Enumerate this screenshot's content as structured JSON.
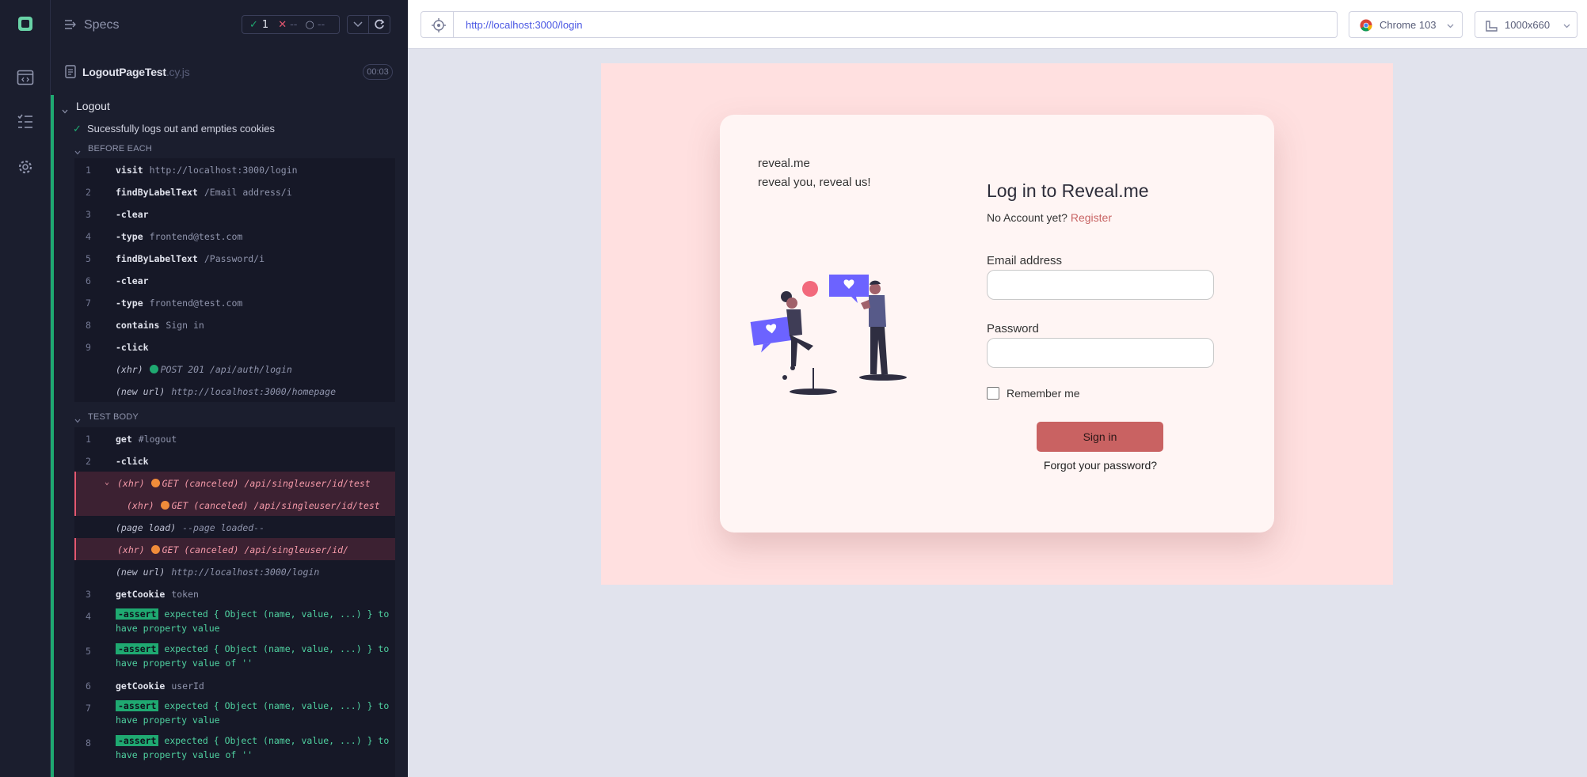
{
  "sidebar": {
    "icons": [
      "cypress-logo-icon",
      "browser-icon",
      "list-icon",
      "gear-icon"
    ]
  },
  "reporter": {
    "specs_label": "Specs",
    "stats": {
      "passed": "1",
      "failed": "--",
      "pending": "--"
    },
    "file": {
      "name": "LogoutPageTest",
      "ext": ".cy.js",
      "duration": "00:03"
    },
    "suite": "Logout",
    "test": "Sucessfully logs out and empties cookies",
    "before_each_label": "BEFORE EACH",
    "test_body_label": "TEST BODY",
    "before_each": [
      {
        "num": "1",
        "name": "visit",
        "msg": "http://localhost:3000/login"
      },
      {
        "num": "2",
        "name": "findByLabelText",
        "msg": "/Email address/i"
      },
      {
        "num": "3",
        "name": "-clear",
        "msg": ""
      },
      {
        "num": "4",
        "name": "-type",
        "msg": "frontend@test.com"
      },
      {
        "num": "5",
        "name": "findByLabelText",
        "msg": "/Password/i"
      },
      {
        "num": "6",
        "name": "-clear",
        "msg": ""
      },
      {
        "num": "7",
        "name": "-type",
        "msg": "frontend@test.com"
      },
      {
        "num": "8",
        "name": "contains",
        "msg": "Sign in"
      },
      {
        "num": "9",
        "name": "-click",
        "msg": ""
      },
      {
        "num": "",
        "name": "(xhr)",
        "msg": "POST 201 /api/auth/login"
      },
      {
        "num": "",
        "name": "(new url)",
        "msg": "http://localhost:3000/homepage"
      }
    ],
    "test_body": [
      {
        "num": "1",
        "name": "get",
        "msg": "#logout"
      },
      {
        "num": "2",
        "name": "-click",
        "msg": ""
      },
      {
        "num": "",
        "name": "(xhr)",
        "msg": "GET (canceled) /api/singleuser/id/test"
      },
      {
        "num": "",
        "name": "(xhr)",
        "msg": "GET (canceled) /api/singleuser/id/test"
      },
      {
        "num": "",
        "name": "(page load)",
        "msg": "--page loaded--"
      },
      {
        "num": "",
        "name": "(xhr)",
        "msg": "GET (canceled) /api/singleuser/id/"
      },
      {
        "num": "",
        "name": "(new url)",
        "msg": "http://localhost:3000/login"
      },
      {
        "num": "3",
        "name": "getCookie",
        "msg": "token"
      },
      {
        "num": "4",
        "name": "-assert",
        "line1": "expected { Object (name, value, ...) } to",
        "line2": "have property  value"
      },
      {
        "num": "5",
        "name": "-assert",
        "line1": "expected { Object (name, value, ...) } to",
        "line2": "have property  value  of  ''"
      },
      {
        "num": "6",
        "name": "getCookie",
        "msg": "userId"
      },
      {
        "num": "7",
        "name": "-assert",
        "line1": "expected { Object (name, value, ...) } to",
        "line2": "have property  value"
      },
      {
        "num": "8",
        "name": "-assert",
        "line1": "expected { Object (name, value, ...) } to",
        "line2": "have property  value  of  ''"
      }
    ]
  },
  "browser": {
    "url": "http://localhost:3000/login",
    "browser_name": "Chrome 103",
    "viewport": "1000x660"
  },
  "app": {
    "brand_name": "reveal.me",
    "tagline": "reveal you, reveal us!",
    "title": "Log in to Reveal.me",
    "no_account_text": "No Account yet?",
    "register_link": "Register",
    "email_label": "Email address",
    "password_label": "Password",
    "remember_label": "Remember me",
    "signin_button": "Sign in",
    "forgot_link": "Forgot your password?"
  },
  "colors": {
    "accent_pass": "#1fa971",
    "fail": "#e45770",
    "warn_dot": "#f08c3a",
    "signin_button": "#c96262",
    "app_background": "#ffe0e0"
  }
}
